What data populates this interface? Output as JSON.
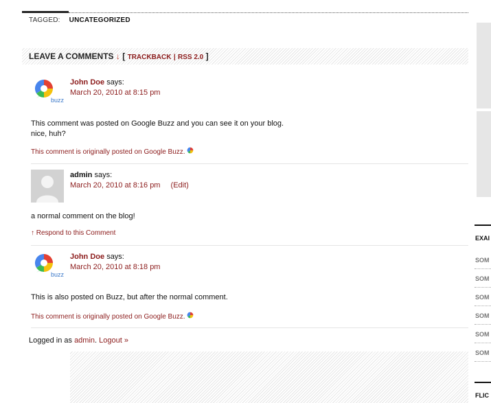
{
  "tagged": {
    "label": "TAGGED:",
    "value": "UNCATEGORIZED"
  },
  "leave": {
    "title": "LEAVE A COMMENTS",
    "arrow": "↓",
    "open": "[",
    "trackback": "TRACKBACK",
    "pipe": "|",
    "rss": "RSS 2.0",
    "close": "]"
  },
  "comments": [
    {
      "author": "John Doe",
      "says": "says:",
      "date": "March 20, 2010 at 8:15 pm",
      "body": [
        "This comment was posted on Google Buzz and you can see it on your blog.",
        "nice, huh?"
      ],
      "origin": "This comment is originally posted on Google Buzz.",
      "avatar_text": "buzz"
    },
    {
      "author": "admin",
      "says": "says:",
      "date": "March 20, 2010 at 8:16 pm",
      "edit": "(Edit)",
      "body": [
        "a normal comment on the blog!"
      ],
      "respond": "↑ Respond to this Comment"
    },
    {
      "author": "John Doe",
      "says": "says:",
      "date": "March 20, 2010 at 8:18 pm",
      "body": [
        "This is also posted on Buzz, but after the normal comment."
      ],
      "origin": "This comment is originally posted on Google Buzz.",
      "avatar_text": "buzz"
    }
  ],
  "logged": {
    "prefix": "Logged in as",
    "user": "admin",
    "dot": ".",
    "logout": "Logout »"
  },
  "sidebar": {
    "heading1": "EXAI",
    "items": [
      "SOM",
      "SOM",
      "SOM",
      "SOM",
      "SOM",
      "SOM"
    ],
    "heading2": "FLIC"
  },
  "icons": {
    "buzz": "google-buzz-icon",
    "gravatar": "default-avatar-icon"
  },
  "colors": {
    "link": "#8b1a1a",
    "arrow": "#c0392b",
    "buzz_text": "#3a78c9"
  }
}
